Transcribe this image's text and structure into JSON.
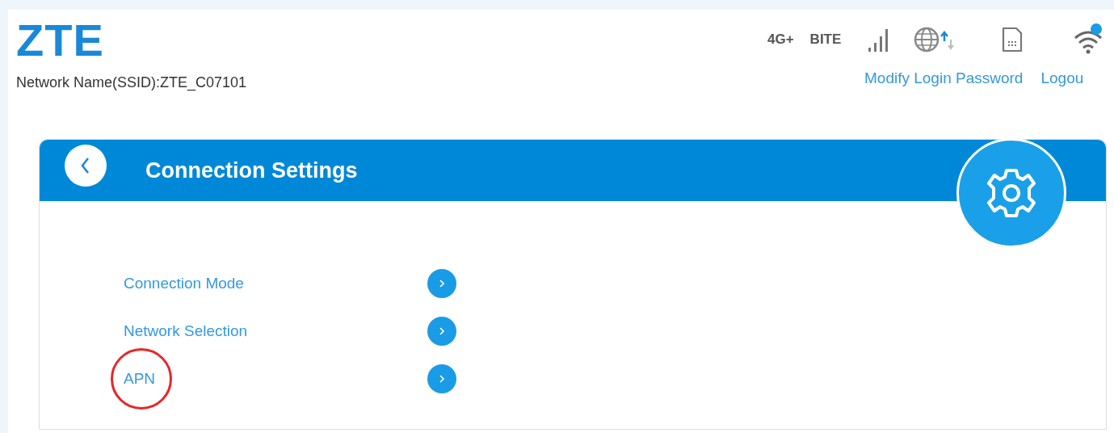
{
  "logo": "ZTE",
  "ssid": "Network Name(SSID):ZTE_C07101",
  "status": {
    "network_type": "4G+",
    "operator": "BITE",
    "wifi_notification": true
  },
  "links": [
    "Modify Login Password",
    "Logou"
  ],
  "panel": {
    "title": "Connection Settings",
    "items": [
      {
        "label": "Connection Mode",
        "highlighted": false
      },
      {
        "label": "Network Selection",
        "highlighted": false
      },
      {
        "label": "APN",
        "highlighted": true
      }
    ]
  }
}
